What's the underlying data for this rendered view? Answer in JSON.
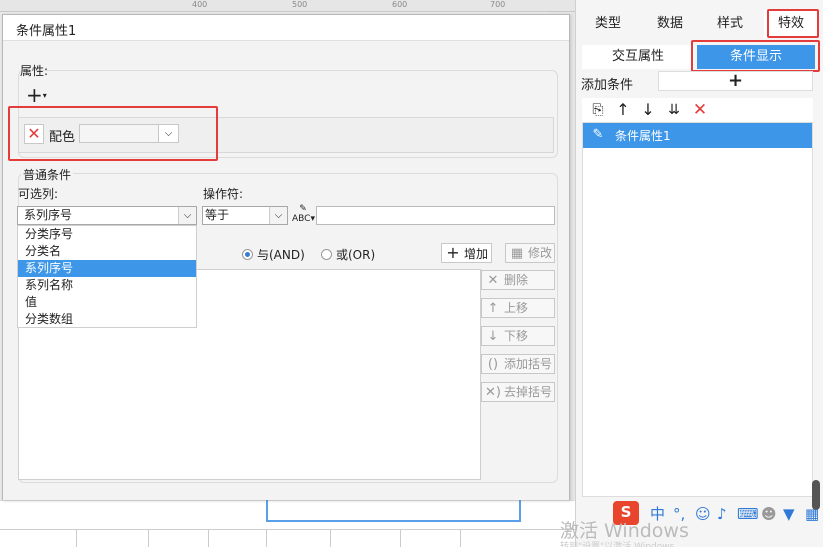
{
  "ruler": {
    "ticks": [
      "400",
      "500",
      "600",
      "700"
    ]
  },
  "dialog": {
    "title": "条件属性1",
    "properties_label": "属性:",
    "add_property": "+",
    "property_name": "配色",
    "color_value": "",
    "normal_conditions_label": "普通条件",
    "optional_column_label": "可选列:",
    "operator_label": "操作符:",
    "column_selected": "系列序号",
    "operator_selected": "等于",
    "value_input": "",
    "column_options": [
      "分类序号",
      "分类名",
      "系列序号",
      "系列名称",
      "值",
      "分类数组"
    ],
    "selected_option_index": 2,
    "radio_and": "与(AND)",
    "radio_or": "或(OR)",
    "buttons": {
      "add": "增加",
      "edit": "修改",
      "delete": "删除",
      "move_up": "上移",
      "move_down": "下移",
      "add_bracket": "添加括号",
      "remove_bracket": "去掉括号"
    }
  },
  "right_panel": {
    "tabs": [
      "类型",
      "数据",
      "样式",
      "特效"
    ],
    "active_tab": "特效",
    "sub_tabs": [
      "交互属性",
      "条件显示"
    ],
    "active_sub_tab": "条件显示",
    "add_condition_label": "添加条件",
    "add_condition_button": "+",
    "condition_items": [
      "条件属性1"
    ]
  },
  "taskbar": {
    "ime_label": "中",
    "watermark": "激活 Windows",
    "watermark_sub": "转到\"设置\"以激活 Windows。"
  },
  "colors": {
    "accent": "#3d96e8",
    "highlight": "#e43b3b"
  }
}
